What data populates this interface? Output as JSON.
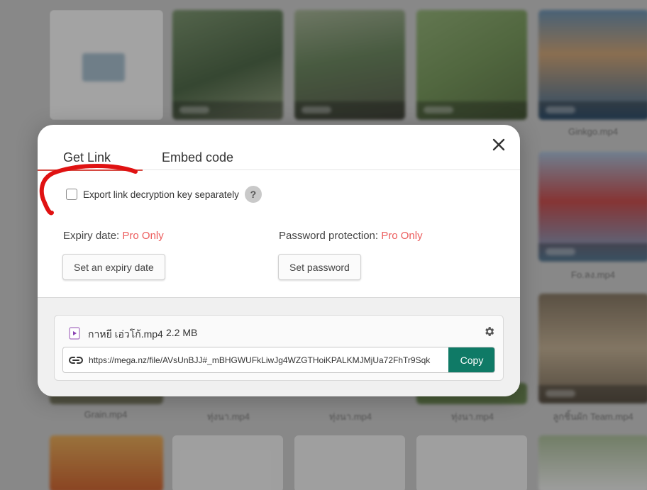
{
  "background": {
    "captions": [
      "Ginkgo.mp4",
      "Fo.ลง.mp4",
      "Grain.mp4",
      "ทุ่งนา.mp4",
      "ทุ่งนา.mp4",
      "ทุ่งนา.mp4",
      "ลูกชิ้นผัก Team.mp4"
    ]
  },
  "dialog": {
    "tabs": {
      "get_link": "Get Link",
      "embed_code": "Embed code"
    },
    "close_label": "×",
    "export_key_label": "Export link decryption key separately",
    "help_label": "?",
    "expiry": {
      "label": "Expiry date:",
      "pro": "Pro Only",
      "button": "Set an expiry date"
    },
    "password": {
      "label": "Password protection:",
      "pro": "Pro Only",
      "button": "Set password"
    },
    "file": {
      "name": "กาหยี เอ่วโก้.mp4",
      "size": "2.2 MB"
    },
    "link": {
      "url": "https://mega.nz/file/AVsUnBJJ#_mBHGWUFkLiwJg4WZGTHoiKPALKMJMjUa72FhTr9Sqk",
      "copy_label": "Copy"
    }
  },
  "colors": {
    "accent_red": "#d64a42",
    "pro_red": "#ec5c5c",
    "copy_green": "#0f7a66"
  },
  "icons": [
    "close-icon",
    "help-icon",
    "video-file-icon",
    "gear-icon",
    "link-icon"
  ]
}
